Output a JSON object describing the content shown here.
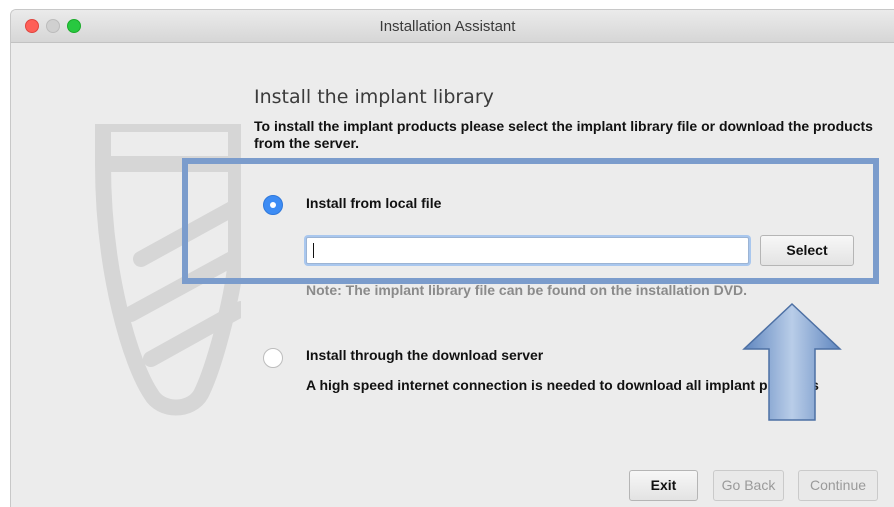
{
  "window": {
    "title": "Installation Assistant"
  },
  "page": {
    "heading": "Install the implant library",
    "intro": "To install the implant products please select the implant library file or download the products from the server."
  },
  "options": {
    "local": {
      "label": "Install from local file",
      "selected": true,
      "file_value": "",
      "select_label": "Select",
      "note": "Note: The implant library file can be found on the installation DVD."
    },
    "server": {
      "label": "Install through the download server",
      "selected": false,
      "note": "A high speed internet connection is needed to download all implant products"
    }
  },
  "footer": {
    "exit_label": "Exit",
    "back_label": "Go Back",
    "continue_label": "Continue"
  },
  "annotation": {
    "highlight_color": "#7b9ccc",
    "arrow_color": "#6f93c6"
  }
}
